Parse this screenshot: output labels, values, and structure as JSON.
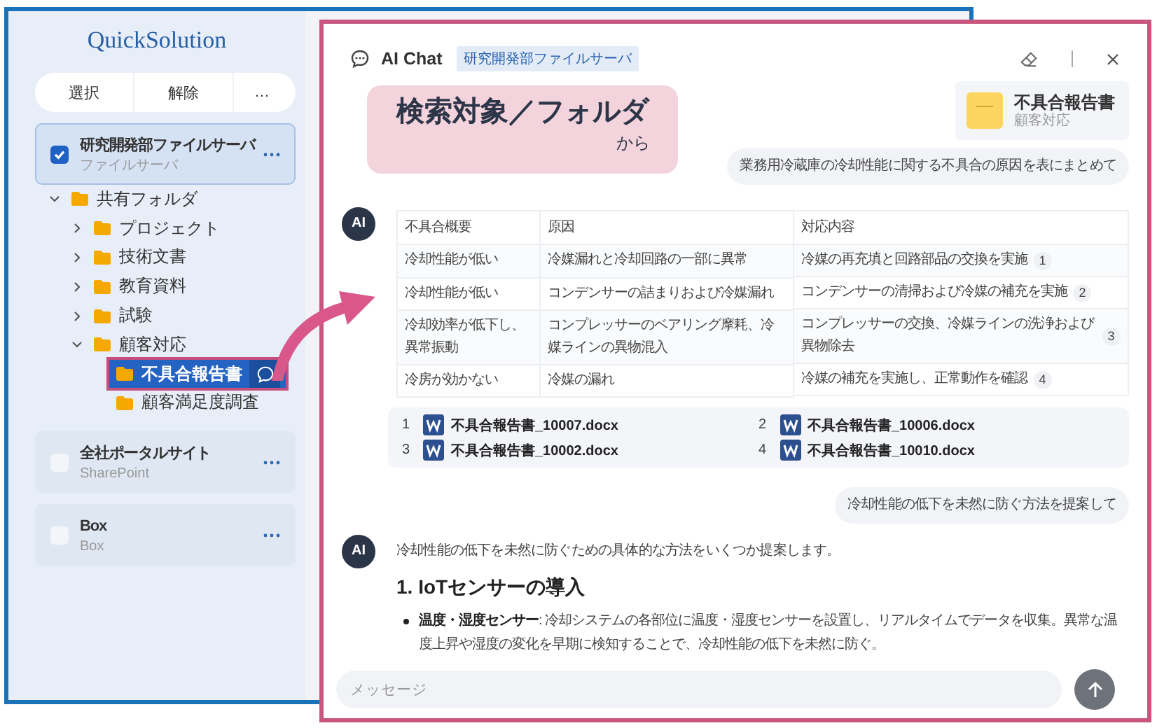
{
  "app": {
    "title": "QuickSolution",
    "toolbar": [
      {
        "label": "選択"
      },
      {
        "label": "解除"
      },
      {
        "label": "…"
      }
    ],
    "sources": [
      {
        "name": "研究開発部ファイルサーバ",
        "type": "ファイルサーバ",
        "checked": true,
        "tree": [
          {
            "label": "共有フォルダ",
            "expanded": true,
            "selected": false,
            "children": [
              {
                "label": "プロジェクト",
                "expanded": false,
                "selected": false
              },
              {
                "label": "技術文書",
                "expanded": false,
                "selected": false
              },
              {
                "label": "教育資料",
                "expanded": false,
                "selected": false
              },
              {
                "label": "試験",
                "expanded": false,
                "selected": false
              },
              {
                "label": "顧客対応",
                "expanded": true,
                "selected": false,
                "children": [
                  {
                    "label": "不具合報告書",
                    "selected": true
                  },
                  {
                    "label": "顧客満足度調査",
                    "selected": false
                  }
                ]
              }
            ]
          }
        ]
      },
      {
        "name": "全社ポータルサイト",
        "type": "SharePoint",
        "checked": false
      },
      {
        "name": "Box",
        "type": "Box",
        "checked": false
      }
    ]
  },
  "chat": {
    "title": "AI Chat",
    "badge": "研究開発部ファイルサーバ",
    "callout": {
      "title": "検索対象／フォルダ",
      "suffix": "から"
    },
    "context": {
      "name": "不具合報告書",
      "folder": "顧客対応"
    },
    "messages": [
      {
        "kind": "user",
        "text": "業務用冷蔵庫の冷却性能に関する不具合の原因を表にまとめて"
      },
      {
        "kind": "ai",
        "avatar": "AI",
        "table": {
          "columns": [
            "不具合概要",
            "原因",
            "対応内容"
          ],
          "rows": [
            {
              "cells": [
                "冷却性能が低い",
                "冷媒漏れと冷却回路の一部に異常",
                "冷媒の再充填と回路部品の交換を実施"
              ],
              "ref": "1"
            },
            {
              "cells": [
                "冷却性能が低い",
                "コンデンサーの詰まりおよび冷媒漏れ",
                "コンデンサーの清掃および冷媒の補充を実施"
              ],
              "ref": "2"
            },
            {
              "cells": [
                "冷却効率が低下し、異常振動",
                "コンプレッサーのベアリング摩耗、冷媒ラインの異物混入",
                "コンプレッサーの交換、冷媒ラインの洗浄および異物除去"
              ],
              "ref": "3"
            },
            {
              "cells": [
                "冷房が効かない",
                "冷媒の漏れ",
                "冷媒の補充を実施し、正常動作を確認"
              ],
              "ref": "4"
            }
          ]
        },
        "sources": [
          {
            "num": "1",
            "file": "不具合報告書_10007.docx"
          },
          {
            "num": "2",
            "file": "不具合報告書_10006.docx"
          },
          {
            "num": "3",
            "file": "不具合報告書_10002.docx"
          },
          {
            "num": "4",
            "file": "不具合報告書_10010.docx"
          }
        ]
      },
      {
        "kind": "user",
        "text": "冷却性能の低下を未然に防ぐ方法を提案して"
      },
      {
        "kind": "ai",
        "avatar": "AI",
        "blocks": [
          {
            "kind": "paragraph",
            "text": "冷却性能の低下を未然に防ぐための具体的な方法をいくつか提案します。"
          },
          {
            "kind": "heading",
            "text": "1. IoTセンサーの導入"
          },
          {
            "kind": "bullet",
            "text": "**温度・湿度センサー**: 冷却システムの各部位に温度・湿度センサーを設置し、リアルタイムでデータを収集。異常な温度上昇や湿度の変化を早期に検知することで、冷却性能の低下を未然に防ぐ。"
          }
        ]
      }
    ],
    "input": {
      "placeholder": "メッセージ"
    }
  }
}
